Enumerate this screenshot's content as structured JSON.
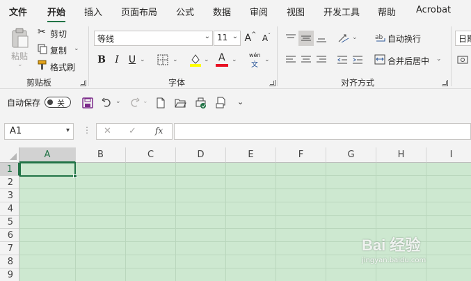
{
  "menu": {
    "tabs": [
      {
        "label": "文件"
      },
      {
        "label": "开始"
      },
      {
        "label": "插入"
      },
      {
        "label": "页面布局"
      },
      {
        "label": "公式"
      },
      {
        "label": "数据"
      },
      {
        "label": "审阅"
      },
      {
        "label": "视图"
      },
      {
        "label": "开发工具"
      },
      {
        "label": "帮助"
      },
      {
        "label": "Acrobat"
      }
    ],
    "active_tab": "开始"
  },
  "ribbon": {
    "clipboard": {
      "paste_label": "粘贴",
      "cut_label": "剪切",
      "copy_label": "复制",
      "format_painter_label": "格式刷",
      "group_label": "剪贴板"
    },
    "font": {
      "font_name": "等线",
      "font_size": "11",
      "bold": "B",
      "italic": "I",
      "underline": "U",
      "grow": "A",
      "shrink": "A",
      "font_color_letter": "A",
      "phonetic_top": "wén",
      "phonetic_bottom": "文",
      "group_label": "字体"
    },
    "alignment": {
      "wrap_text_label": "自动换行",
      "merge_center_label": "合并后居中",
      "group_label": "对齐方式"
    },
    "number": {
      "format_partial": "日期"
    }
  },
  "quick_access": {
    "autosave_label": "自动保存",
    "autosave_state": "关"
  },
  "formula_bar": {
    "name_box": "A1",
    "cancel": "✕",
    "enter": "✓",
    "fx": "fx",
    "formula_value": ""
  },
  "sheet": {
    "columns": [
      "A",
      "B",
      "C",
      "D",
      "E",
      "F",
      "G",
      "H",
      "I"
    ],
    "rows": [
      "1",
      "2",
      "3",
      "4",
      "5",
      "6",
      "7",
      "8",
      "9"
    ],
    "selected_cell": "A1"
  },
  "watermark": {
    "main": "Bai 经验",
    "sub": "jingyan.baidu.com"
  },
  "colors": {
    "accent": "#217346",
    "grid_fill": "#cde8d0",
    "ribbon_bg": "#f3f3f3",
    "highlight_yellow": "#ffff00",
    "font_red": "#e81123",
    "save_purple": "#7b2a8a"
  }
}
